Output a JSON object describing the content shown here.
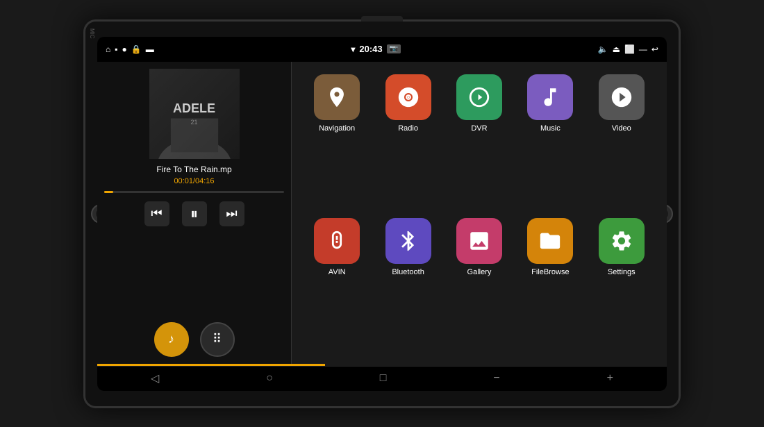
{
  "device": {
    "mic_label": "MIC"
  },
  "status_bar": {
    "time": "20:43",
    "left_icons": [
      "home",
      "windows",
      "record",
      "lock",
      "battery"
    ],
    "right_icons": [
      "wifi",
      "camera",
      "volume",
      "eject",
      "screen",
      "dash",
      "back"
    ]
  },
  "music_player": {
    "artist": "ADELE",
    "track": "Fire To The Rain.mp",
    "time_current": "00:01",
    "time_total": "04:16",
    "time_display": "00:01/04:16",
    "progress_percent": 5,
    "album_art_line1": "ADELE",
    "album_art_line2": "21"
  },
  "player_controls": {
    "rewind": "⏮",
    "play_pause": "⏸",
    "forward": "⏭"
  },
  "bottom_buttons": {
    "music_icon": "♪",
    "apps_icon": "⠿"
  },
  "apps": {
    "row1": [
      {
        "id": "navigation",
        "label": "Navigation",
        "color_class": "nav-icon",
        "icon": "nav"
      },
      {
        "id": "radio",
        "label": "Radio",
        "color_class": "radio-icon",
        "icon": "radio"
      },
      {
        "id": "dvr",
        "label": "DVR",
        "color_class": "dvr-icon",
        "icon": "dvr"
      },
      {
        "id": "music",
        "label": "Music",
        "color_class": "music-icon",
        "icon": "music"
      },
      {
        "id": "video",
        "label": "Video",
        "color_class": "video-icon",
        "icon": "video"
      }
    ],
    "row2": [
      {
        "id": "avin",
        "label": "AVIN",
        "color_class": "avin-icon",
        "icon": "avin"
      },
      {
        "id": "bluetooth",
        "label": "Bluetooth",
        "color_class": "bluetooth-icon",
        "icon": "bluetooth"
      },
      {
        "id": "gallery",
        "label": "Gallery",
        "color_class": "gallery-icon",
        "icon": "gallery"
      },
      {
        "id": "filebrowser",
        "label": "FileBrowse",
        "color_class": "filebrowser-icon",
        "icon": "folder"
      },
      {
        "id": "settings",
        "label": "Settings",
        "color_class": "settings-icon",
        "icon": "settings"
      }
    ]
  },
  "nav_bar": {
    "back": "◁",
    "home": "○",
    "recents": "□",
    "vol_down": "−",
    "vol_up": "+"
  }
}
